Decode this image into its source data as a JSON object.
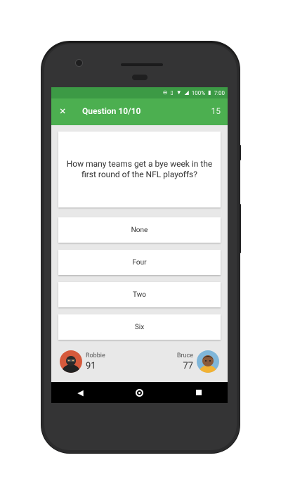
{
  "status_bar": {
    "battery": "100%",
    "time": "7:00"
  },
  "app_bar": {
    "close_icon": "×",
    "title": "Question 10/10",
    "timer": "15"
  },
  "question": {
    "text": "How many teams get a bye week in the first round of the NFL playoffs?"
  },
  "answers": [
    {
      "label": "None"
    },
    {
      "label": "Four"
    },
    {
      "label": "Two"
    },
    {
      "label": "Six"
    }
  ],
  "players": {
    "left": {
      "name": "Robbie",
      "score": "91"
    },
    "right": {
      "name": "Bruce",
      "score": "77"
    }
  },
  "nav": {
    "back_icon": "◀"
  },
  "colors": {
    "appbar": "#4caf50",
    "statusbar": "#3c9a45"
  }
}
